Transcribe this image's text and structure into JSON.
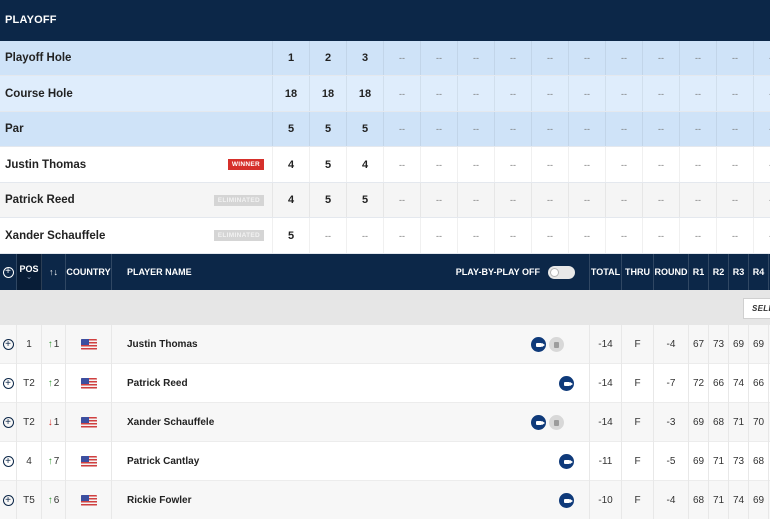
{
  "playoff": {
    "title": "PLAYOFF",
    "rows": [
      {
        "label": "Playoff Hole",
        "values": [
          "1",
          "2",
          "3",
          "--",
          "--",
          "--",
          "--",
          "--",
          "--",
          "--",
          "--",
          "--",
          "--",
          "--"
        ]
      },
      {
        "label": "Course Hole",
        "values": [
          "18",
          "18",
          "18",
          "--",
          "--",
          "--",
          "--",
          "--",
          "--",
          "--",
          "--",
          "--",
          "--",
          "--"
        ]
      },
      {
        "label": "Par",
        "values": [
          "5",
          "5",
          "5",
          "--",
          "--",
          "--",
          "--",
          "--",
          "--",
          "--",
          "--",
          "--",
          "--",
          "--"
        ]
      }
    ],
    "players": [
      {
        "name": "Justin Thomas",
        "status": "WINNER",
        "status_type": "winner",
        "values": [
          "4",
          "5",
          "4",
          "--",
          "--",
          "--",
          "--",
          "--",
          "--",
          "--",
          "--",
          "--",
          "--",
          "--"
        ]
      },
      {
        "name": "Patrick Reed",
        "status": "ELIMINATED",
        "status_type": "eliminated",
        "values": [
          "4",
          "5",
          "5",
          "--",
          "--",
          "--",
          "--",
          "--",
          "--",
          "--",
          "--",
          "--",
          "--",
          "--"
        ]
      },
      {
        "name": "Xander Schauffele",
        "status": "ELIMINATED",
        "status_type": "eliminated",
        "values": [
          "5",
          "--",
          "--",
          "--",
          "--",
          "--",
          "--",
          "--",
          "--",
          "--",
          "--",
          "--",
          "--",
          "--"
        ]
      }
    ]
  },
  "leaderboard": {
    "headers": {
      "pos": "POS",
      "move": "↑↓",
      "country": "COUNTRY",
      "player_name": "PLAYER NAME",
      "play_by_play": "PLAY-BY-PLAY OFF",
      "total": "TOTAL",
      "thru": "THRU",
      "round": "ROUND",
      "r1": "R1",
      "r2": "R2",
      "r3": "R3",
      "r4": "R4"
    },
    "play_by_play_enabled": false,
    "select_label": "SELECT",
    "rows": [
      {
        "pos": "1",
        "move_dir": "up",
        "move": "1",
        "country": "USA",
        "name": "Justin Thomas",
        "video": true,
        "scorecard": true,
        "total": "-14",
        "thru": "F",
        "round": "-4",
        "r1": "67",
        "r2": "73",
        "r3": "69",
        "r4": "69"
      },
      {
        "pos": "T2",
        "move_dir": "up",
        "move": "2",
        "country": "USA",
        "name": "Patrick Reed",
        "video": true,
        "scorecard": false,
        "total": "-14",
        "thru": "F",
        "round": "-7",
        "r1": "72",
        "r2": "66",
        "r3": "74",
        "r4": "66"
      },
      {
        "pos": "T2",
        "move_dir": "down",
        "move": "1",
        "country": "USA",
        "name": "Xander Schauffele",
        "video": true,
        "scorecard": true,
        "total": "-14",
        "thru": "F",
        "round": "-3",
        "r1": "69",
        "r2": "68",
        "r3": "71",
        "r4": "70"
      },
      {
        "pos": "4",
        "move_dir": "up",
        "move": "7",
        "country": "USA",
        "name": "Patrick Cantlay",
        "video": true,
        "scorecard": false,
        "total": "-11",
        "thru": "F",
        "round": "-5",
        "r1": "69",
        "r2": "71",
        "r3": "73",
        "r4": "68"
      },
      {
        "pos": "T5",
        "move_dir": "up",
        "move": "6",
        "country": "USA",
        "name": "Rickie Fowler",
        "video": true,
        "scorecard": false,
        "total": "-10",
        "thru": "F",
        "round": "-4",
        "r1": "68",
        "r2": "71",
        "r3": "74",
        "r4": "69"
      }
    ]
  },
  "colors": {
    "navy": "#0c2748",
    "winner_red": "#d6302b",
    "up_green": "#3a9a3a",
    "down_red": "#d6302b",
    "video_blue": "#0f3a7a"
  }
}
